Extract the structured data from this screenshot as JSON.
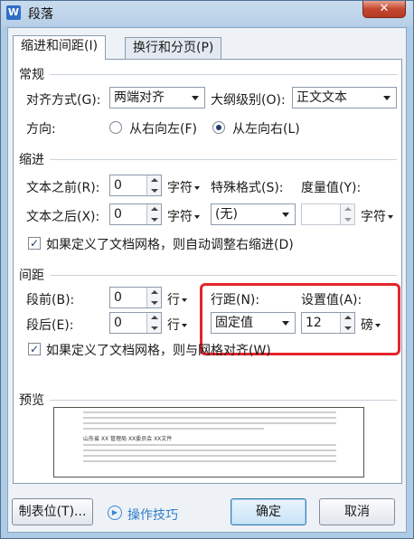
{
  "window": {
    "title": "段落",
    "close": "✕",
    "app_icon": "W"
  },
  "tabs": [
    {
      "label": "缩进和间距(I)"
    },
    {
      "label": "换行和分页(P)"
    }
  ],
  "general": {
    "section": "常规",
    "align_label": "对齐方式(G):",
    "align_value": "两端对齐",
    "outline_label": "大纲级别(O):",
    "outline_value": "正文文本",
    "direction_label": "方向:",
    "rtl_label": "从右向左(F)",
    "ltr_label": "从左向右(L)",
    "direction_selected": "ltr"
  },
  "indent": {
    "section": "缩进",
    "before_label": "文本之前(R):",
    "before_value": "0",
    "before_unit": "字符",
    "after_label": "文本之后(X):",
    "after_value": "0",
    "after_unit": "字符",
    "special_label": "特殊格式(S):",
    "special_value": "(无)",
    "measure_label": "度量值(Y):",
    "measure_value": "",
    "measure_unit": "字符",
    "grid_check_label": "如果定义了文档网格，则自动调整右缩进(D)",
    "grid_checked": true
  },
  "spacing": {
    "section": "间距",
    "before_label": "段前(B):",
    "before_value": "0",
    "before_unit": "行",
    "after_label": "段后(E):",
    "after_value": "0",
    "after_unit": "行",
    "line_label": "行距(N):",
    "line_value": "固定值",
    "setting_label": "设置值(A):",
    "setting_value": "12",
    "setting_unit": "磅",
    "grid_check_label": "如果定义了文档网格，则与网格对齐(W)",
    "grid_checked": true
  },
  "preview": {
    "section": "预览",
    "sample_text": "山东省 XX 管理局 XX委员会 XX文件"
  },
  "footer": {
    "tabs_button": "制表位(T)...",
    "tips_link": "操作技巧",
    "ok": "确定",
    "cancel": "取消"
  },
  "colors": {
    "highlight_box": "#e6232c",
    "link": "#2f7ccb"
  }
}
